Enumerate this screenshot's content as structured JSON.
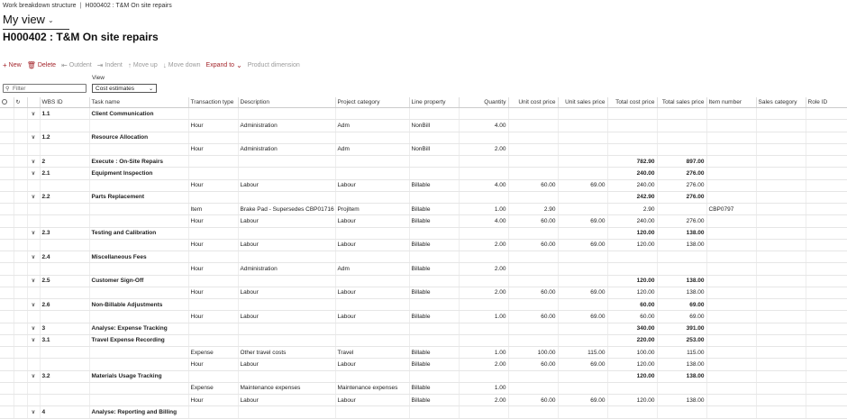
{
  "breadcrumb": {
    "part1": "Work breakdown structure",
    "separator": "|",
    "part2": "H000402 : T&M On site repairs"
  },
  "view": {
    "title": "My view"
  },
  "page_title": "H000402 : T&M On site repairs",
  "toolbar": {
    "new": "New",
    "delete": "Delete",
    "outdent": "Outdent",
    "indent": "Indent",
    "move_up": "Move up",
    "move_down": "Move down",
    "expand_to": "Expand to",
    "product_dimension": "Product dimension"
  },
  "filter": {
    "placeholder": "Filter"
  },
  "view_select": {
    "label": "View",
    "value": "Cost estimates"
  },
  "columns": [
    "WBS ID",
    "Task name",
    "Transaction type",
    "Description",
    "Project category",
    "Line property",
    "Quantity",
    "Unit cost price",
    "Unit sales price",
    "Total cost price",
    "Total sales price",
    "Item number",
    "Sales category",
    "Role ID"
  ],
  "rows": [
    {
      "sum": true,
      "expand": true,
      "wbs": "1.1",
      "task": "Client Communication",
      "ttype": "",
      "desc": "",
      "cat": "",
      "line": "",
      "qty": "",
      "ucp": "",
      "usp": "",
      "tcp": "",
      "tsp": "",
      "item": "",
      "scat": "",
      "role": ""
    },
    {
      "sum": false,
      "expand": false,
      "wbs": "",
      "task": "",
      "ttype": "Hour",
      "desc": "Administration",
      "cat": "Adm",
      "line": "NonBill",
      "qty": "4.00",
      "ucp": "",
      "usp": "",
      "tcp": "",
      "tsp": "",
      "item": "",
      "scat": "",
      "role": ""
    },
    {
      "sum": true,
      "expand": true,
      "wbs": "1.2",
      "task": "Resource Allocation",
      "ttype": "",
      "desc": "",
      "cat": "",
      "line": "",
      "qty": "",
      "ucp": "",
      "usp": "",
      "tcp": "",
      "tsp": "",
      "item": "",
      "scat": "",
      "role": ""
    },
    {
      "sum": false,
      "expand": false,
      "wbs": "",
      "task": "",
      "ttype": "Hour",
      "desc": "Administration",
      "cat": "Adm",
      "line": "NonBill",
      "qty": "2.00",
      "ucp": "",
      "usp": "",
      "tcp": "",
      "tsp": "",
      "item": "",
      "scat": "",
      "role": ""
    },
    {
      "sum": true,
      "expand": true,
      "wbs": "2",
      "task": "Execute : On-Site Repairs",
      "ttype": "",
      "desc": "",
      "cat": "",
      "line": "",
      "qty": "",
      "ucp": "",
      "usp": "",
      "tcp": "782.90",
      "tsp": "897.00",
      "item": "",
      "scat": "",
      "role": ""
    },
    {
      "sum": true,
      "expand": true,
      "wbs": "2.1",
      "task": "Equipment Inspection",
      "ttype": "",
      "desc": "",
      "cat": "",
      "line": "",
      "qty": "",
      "ucp": "",
      "usp": "",
      "tcp": "240.00",
      "tsp": "276.00",
      "item": "",
      "scat": "",
      "role": ""
    },
    {
      "sum": false,
      "expand": false,
      "wbs": "",
      "task": "",
      "ttype": "Hour",
      "desc": "Labour",
      "cat": "Labour",
      "line": "Billable",
      "qty": "4.00",
      "ucp": "60.00",
      "usp": "69.00",
      "tcp": "240.00",
      "tsp": "276.00",
      "item": "",
      "scat": "",
      "role": ""
    },
    {
      "sum": true,
      "expand": true,
      "wbs": "2.2",
      "task": "Parts Replacement",
      "ttype": "",
      "desc": "",
      "cat": "",
      "line": "",
      "qty": "",
      "ucp": "",
      "usp": "",
      "tcp": "242.90",
      "tsp": "276.00",
      "item": "",
      "scat": "",
      "role": ""
    },
    {
      "sum": false,
      "expand": false,
      "wbs": "",
      "task": "",
      "ttype": "Item",
      "desc": "Brake Pad - Supersedes CBP01716",
      "cat": "ProjItem",
      "line": "Billable",
      "qty": "1.00",
      "ucp": "2.90",
      "usp": "",
      "tcp": "2.90",
      "tsp": "",
      "item": "CBP0797",
      "scat": "",
      "role": ""
    },
    {
      "sum": false,
      "expand": false,
      "wbs": "",
      "task": "",
      "ttype": "Hour",
      "desc": "Labour",
      "cat": "Labour",
      "line": "Billable",
      "qty": "4.00",
      "ucp": "60.00",
      "usp": "69.00",
      "tcp": "240.00",
      "tsp": "276.00",
      "item": "",
      "scat": "",
      "role": ""
    },
    {
      "sum": true,
      "expand": true,
      "wbs": "2.3",
      "task": "Testing and Calibration",
      "ttype": "",
      "desc": "",
      "cat": "",
      "line": "",
      "qty": "",
      "ucp": "",
      "usp": "",
      "tcp": "120.00",
      "tsp": "138.00",
      "item": "",
      "scat": "",
      "role": ""
    },
    {
      "sum": false,
      "expand": false,
      "wbs": "",
      "task": "",
      "ttype": "Hour",
      "desc": "Labour",
      "cat": "Labour",
      "line": "Billable",
      "qty": "2.00",
      "ucp": "60.00",
      "usp": "69.00",
      "tcp": "120.00",
      "tsp": "138.00",
      "item": "",
      "scat": "",
      "role": ""
    },
    {
      "sum": true,
      "expand": true,
      "wbs": "2.4",
      "task": "Miscellaneous Fees",
      "ttype": "",
      "desc": "",
      "cat": "",
      "line": "",
      "qty": "",
      "ucp": "",
      "usp": "",
      "tcp": "",
      "tsp": "",
      "item": "",
      "scat": "",
      "role": ""
    },
    {
      "sum": false,
      "expand": false,
      "wbs": "",
      "task": "",
      "ttype": "Hour",
      "desc": "Administration",
      "cat": "Adm",
      "line": "Billable",
      "qty": "2.00",
      "ucp": "",
      "usp": "",
      "tcp": "",
      "tsp": "",
      "item": "",
      "scat": "",
      "role": ""
    },
    {
      "sum": true,
      "expand": true,
      "wbs": "2.5",
      "task": "Customer Sign-Off",
      "ttype": "",
      "desc": "",
      "cat": "",
      "line": "",
      "qty": "",
      "ucp": "",
      "usp": "",
      "tcp": "120.00",
      "tsp": "138.00",
      "item": "",
      "scat": "",
      "role": ""
    },
    {
      "sum": false,
      "expand": false,
      "wbs": "",
      "task": "",
      "ttype": "Hour",
      "desc": "Labour",
      "cat": "Labour",
      "line": "Billable",
      "qty": "2.00",
      "ucp": "60.00",
      "usp": "69.00",
      "tcp": "120.00",
      "tsp": "138.00",
      "item": "",
      "scat": "",
      "role": ""
    },
    {
      "sum": true,
      "expand": true,
      "wbs": "2.6",
      "task": "Non-Billable Adjustments",
      "ttype": "",
      "desc": "",
      "cat": "",
      "line": "",
      "qty": "",
      "ucp": "",
      "usp": "",
      "tcp": "60.00",
      "tsp": "69.00",
      "item": "",
      "scat": "",
      "role": ""
    },
    {
      "sum": false,
      "expand": false,
      "wbs": "",
      "task": "",
      "ttype": "Hour",
      "desc": "Labour",
      "cat": "Labour",
      "line": "Billable",
      "qty": "1.00",
      "ucp": "60.00",
      "usp": "69.00",
      "tcp": "60.00",
      "tsp": "69.00",
      "item": "",
      "scat": "",
      "role": ""
    },
    {
      "sum": true,
      "expand": true,
      "wbs": "3",
      "task": "Analyse: Expense Tracking",
      "ttype": "",
      "desc": "",
      "cat": "",
      "line": "",
      "qty": "",
      "ucp": "",
      "usp": "",
      "tcp": "340.00",
      "tsp": "391.00",
      "item": "",
      "scat": "",
      "role": ""
    },
    {
      "sum": true,
      "expand": true,
      "wbs": "3.1",
      "task": "Travel Expense Recording",
      "ttype": "",
      "desc": "",
      "cat": "",
      "line": "",
      "qty": "",
      "ucp": "",
      "usp": "",
      "tcp": "220.00",
      "tsp": "253.00",
      "item": "",
      "scat": "",
      "role": ""
    },
    {
      "sum": false,
      "expand": false,
      "wbs": "",
      "task": "",
      "ttype": "Expense",
      "desc": "Other travel costs",
      "cat": "Travel",
      "line": "Billable",
      "qty": "1.00",
      "ucp": "100.00",
      "usp": "115.00",
      "tcp": "100.00",
      "tsp": "115.00",
      "item": "",
      "scat": "",
      "role": ""
    },
    {
      "sum": false,
      "expand": false,
      "wbs": "",
      "task": "",
      "ttype": "Hour",
      "desc": "Labour",
      "cat": "Labour",
      "line": "Billable",
      "qty": "2.00",
      "ucp": "60.00",
      "usp": "69.00",
      "tcp": "120.00",
      "tsp": "138.00",
      "item": "",
      "scat": "",
      "role": ""
    },
    {
      "sum": true,
      "expand": true,
      "wbs": "3.2",
      "task": "Materials Usage Tracking",
      "ttype": "",
      "desc": "",
      "cat": "",
      "line": "",
      "qty": "",
      "ucp": "",
      "usp": "",
      "tcp": "120.00",
      "tsp": "138.00",
      "item": "",
      "scat": "",
      "role": ""
    },
    {
      "sum": false,
      "expand": false,
      "wbs": "",
      "task": "",
      "ttype": "Expense",
      "desc": "Maintenance expenses",
      "cat": "Maintenance expenses",
      "line": "Billable",
      "qty": "1.00",
      "ucp": "",
      "usp": "",
      "tcp": "",
      "tsp": "",
      "item": "",
      "scat": "",
      "role": ""
    },
    {
      "sum": false,
      "expand": false,
      "wbs": "",
      "task": "",
      "ttype": "Hour",
      "desc": "Labour",
      "cat": "Labour",
      "line": "Billable",
      "qty": "2.00",
      "ucp": "60.00",
      "usp": "69.00",
      "tcp": "120.00",
      "tsp": "138.00",
      "item": "",
      "scat": "",
      "role": ""
    },
    {
      "sum": true,
      "expand": true,
      "wbs": "4",
      "task": "Analyse: Reporting and Billing",
      "ttype": "",
      "desc": "",
      "cat": "",
      "line": "",
      "qty": "",
      "ucp": "",
      "usp": "",
      "tcp": "",
      "tsp": "",
      "item": "",
      "scat": "",
      "role": ""
    }
  ],
  "icons": {
    "new": "plus-icon",
    "delete": "trash-icon",
    "outdent": "outdent-icon",
    "indent": "indent-icon",
    "move_up": "arrow-up-icon",
    "move_down": "arrow-down-icon",
    "expand_to": "chevron-down-icon",
    "filter": "funnel-icon",
    "select_all": "circle-icon",
    "refresh": "refresh-icon",
    "expand_row": "chevron-down-icon"
  },
  "colors": {
    "accent": "#a4262c"
  }
}
